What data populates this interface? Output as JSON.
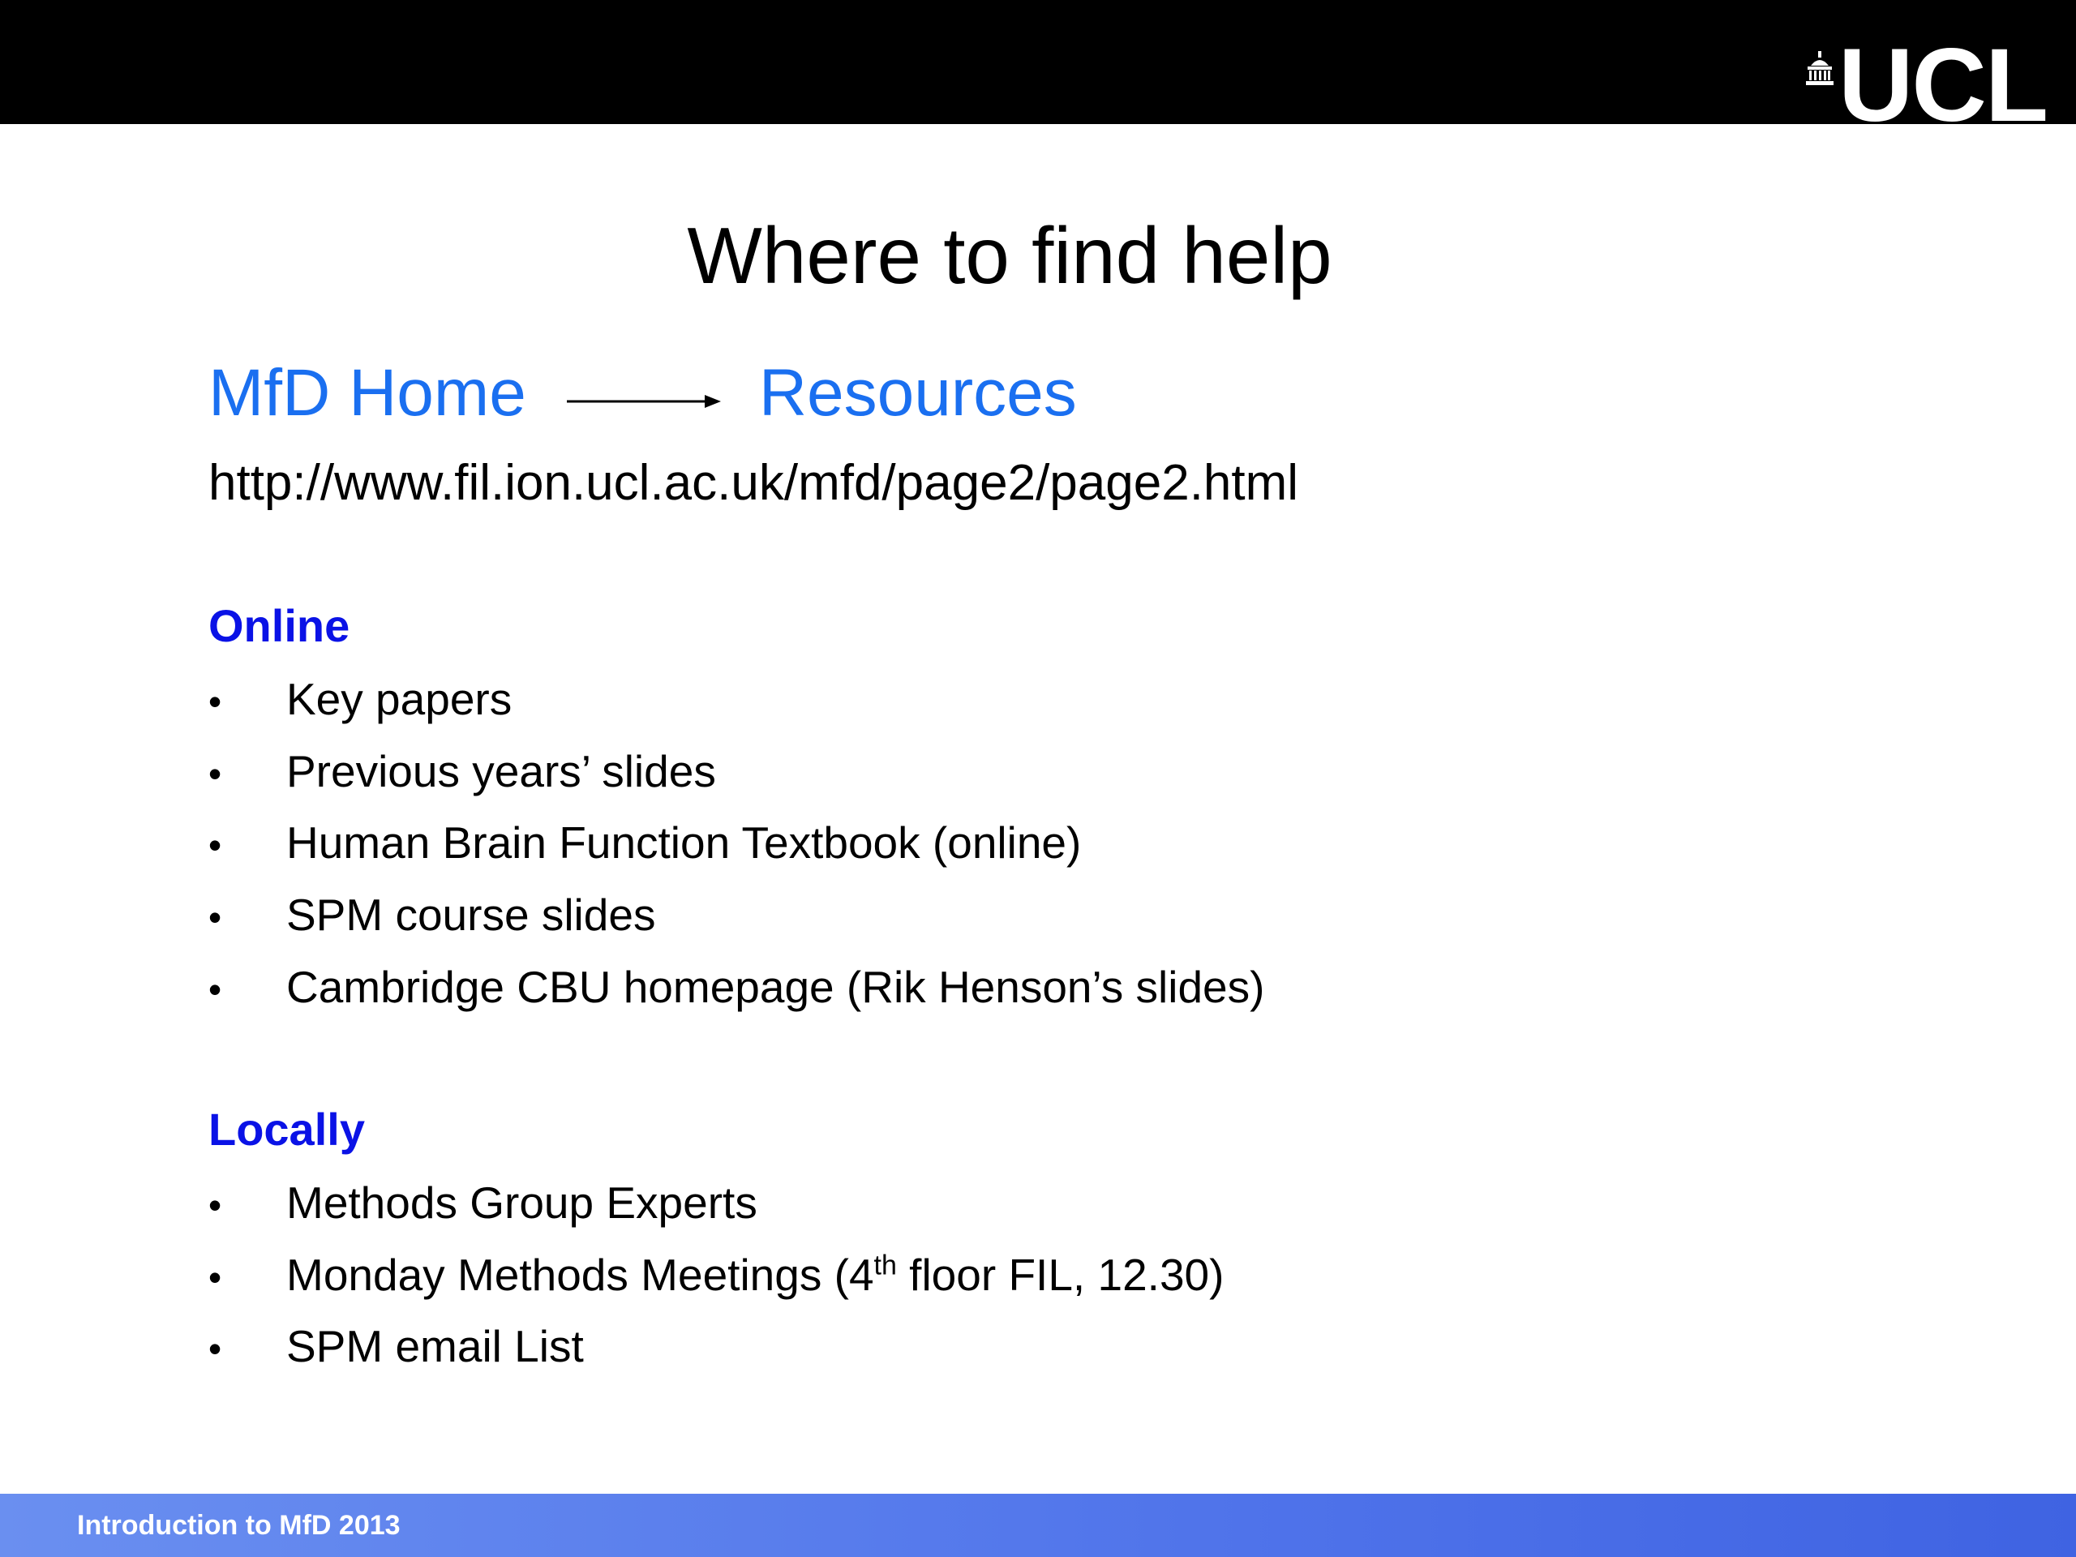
{
  "header": {
    "logo_text": "UCL"
  },
  "slide": {
    "title": "Where to find help",
    "nav": {
      "home_link": "MfD Home",
      "resources_link": "Resources"
    },
    "url": "http://www.fil.ion.ucl.ac.uk/mfd/page2/page2.html",
    "online": {
      "heading": "Online",
      "items": [
        "Key papers",
        "Previous years’ slides",
        "Human Brain Function Textbook (online)",
        "SPM course slides",
        "Cambridge CBU homepage (Rik Henson’s slides)"
      ]
    },
    "locally": {
      "heading": "Locally",
      "items": [
        "Methods Group Experts",
        {
          "before": "Monday Methods Meetings (4",
          "sup": "th",
          "after": " floor FIL, 12.30)"
        },
        "SPM email List"
      ]
    }
  },
  "footer": {
    "text": "Introduction to MfD 2013"
  },
  "colors": {
    "link_blue": "#1a6ff0",
    "heading_blue": "#0a12e6",
    "footer_blue": "#4f73ea",
    "top_bar": "#000000"
  }
}
